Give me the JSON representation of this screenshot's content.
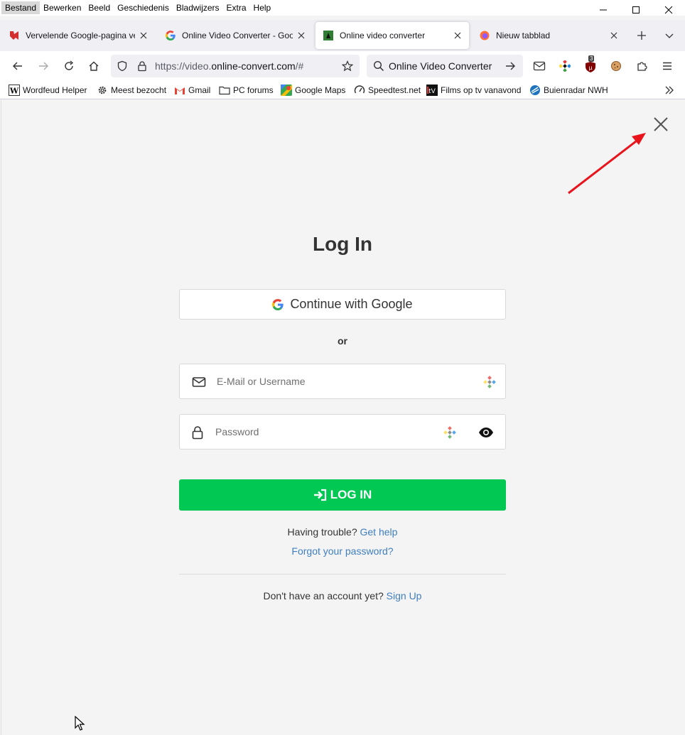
{
  "menu": [
    "Bestand",
    "Bewerken",
    "Beeld",
    "Geschiedenis",
    "Bladwijzers",
    "Extra",
    "Help"
  ],
  "tabs": [
    {
      "title": "Vervelende Google-pagina ver..."
    },
    {
      "title": "Online Video Converter - Goog..."
    },
    {
      "title": "Online video converter"
    },
    {
      "title": "Nieuw tabblad"
    }
  ],
  "nav": {
    "url_prefix": "https://video.",
    "url_domain": "online-convert.com",
    "url_suffix": "/#",
    "search_text": "Online Video Converter",
    "badge_count": "3"
  },
  "bookmarks": [
    "Wordfeud Helper",
    "Meest bezocht",
    "Gmail",
    "PC forums",
    "Google Maps",
    "Speedtest.net",
    "Films op tv vanavond",
    "Buienradar NWH"
  ],
  "login": {
    "title": "Log In",
    "google_label": "Continue with Google",
    "or_label": "or",
    "email_placeholder": "E-Mail or Username",
    "password_placeholder": "Password",
    "login_label": "LOG IN",
    "trouble_text": "Having trouble?",
    "help_link": "Get help",
    "forgot_link": "Forgot your password?",
    "no_account_text": "Don't have an account yet?",
    "signup_link": "Sign Up"
  },
  "colors": {
    "accent_green": "#00c853",
    "link_blue": "#3f7fc0",
    "annotation_red": "#e8131b"
  }
}
